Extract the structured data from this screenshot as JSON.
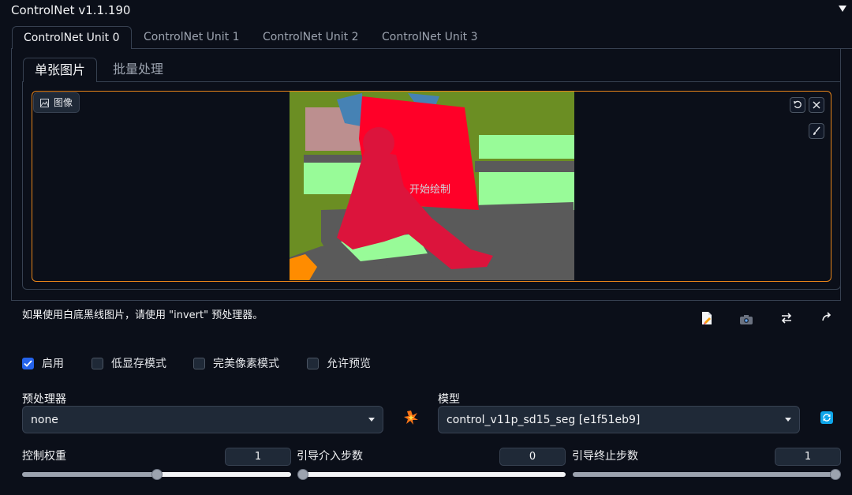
{
  "header": {
    "title": "ControlNet v1.1.190",
    "collapse_icon": "triangle-down-icon"
  },
  "unit_tabs": [
    {
      "label": "ControlNet Unit 0",
      "active": true
    },
    {
      "label": "ControlNet Unit 1",
      "active": false
    },
    {
      "label": "ControlNet Unit 2",
      "active": false
    },
    {
      "label": "ControlNet Unit 3",
      "active": false
    }
  ],
  "sub_tabs": [
    {
      "label": "单张图片",
      "active": true
    },
    {
      "label": "批量处理",
      "active": false
    }
  ],
  "image_panel": {
    "label": "图像",
    "hint": "开始绘制",
    "accent_color": "#e58319",
    "corner_icons": [
      "undo-icon",
      "close-icon",
      "brush-icon"
    ]
  },
  "info": {
    "text": "如果使用白底黑线图片，请使用 \"invert\" 预处理器。"
  },
  "toolbar_icons": [
    "new-canvas-icon",
    "camera-icon",
    "swap-icon",
    "send-dimensions-icon"
  ],
  "checkboxes": [
    {
      "label": "启用",
      "checked": true
    },
    {
      "label": "低显存模式",
      "checked": false
    },
    {
      "label": "完美像素模式",
      "checked": false
    },
    {
      "label": "允许预览",
      "checked": false
    }
  ],
  "preprocessor": {
    "label": "预处理器",
    "value": "none",
    "run_icon": "explosion-icon"
  },
  "model": {
    "label": "模型",
    "value": "control_v11p_sd15_seg [e1f51eb9]",
    "refresh_icon": "refresh-icon"
  },
  "sliders": [
    {
      "label": "控制权重",
      "value": "1",
      "fraction": 0.5
    },
    {
      "label": "引导介入步数",
      "value": "0",
      "fraction": 0.0
    },
    {
      "label": "引导终止步数",
      "value": "1",
      "fraction": 1.0
    }
  ],
  "colors": {
    "background": "#0b0f19",
    "panel": "#1f2937",
    "accent": "#e58319",
    "check": "#2563eb"
  }
}
